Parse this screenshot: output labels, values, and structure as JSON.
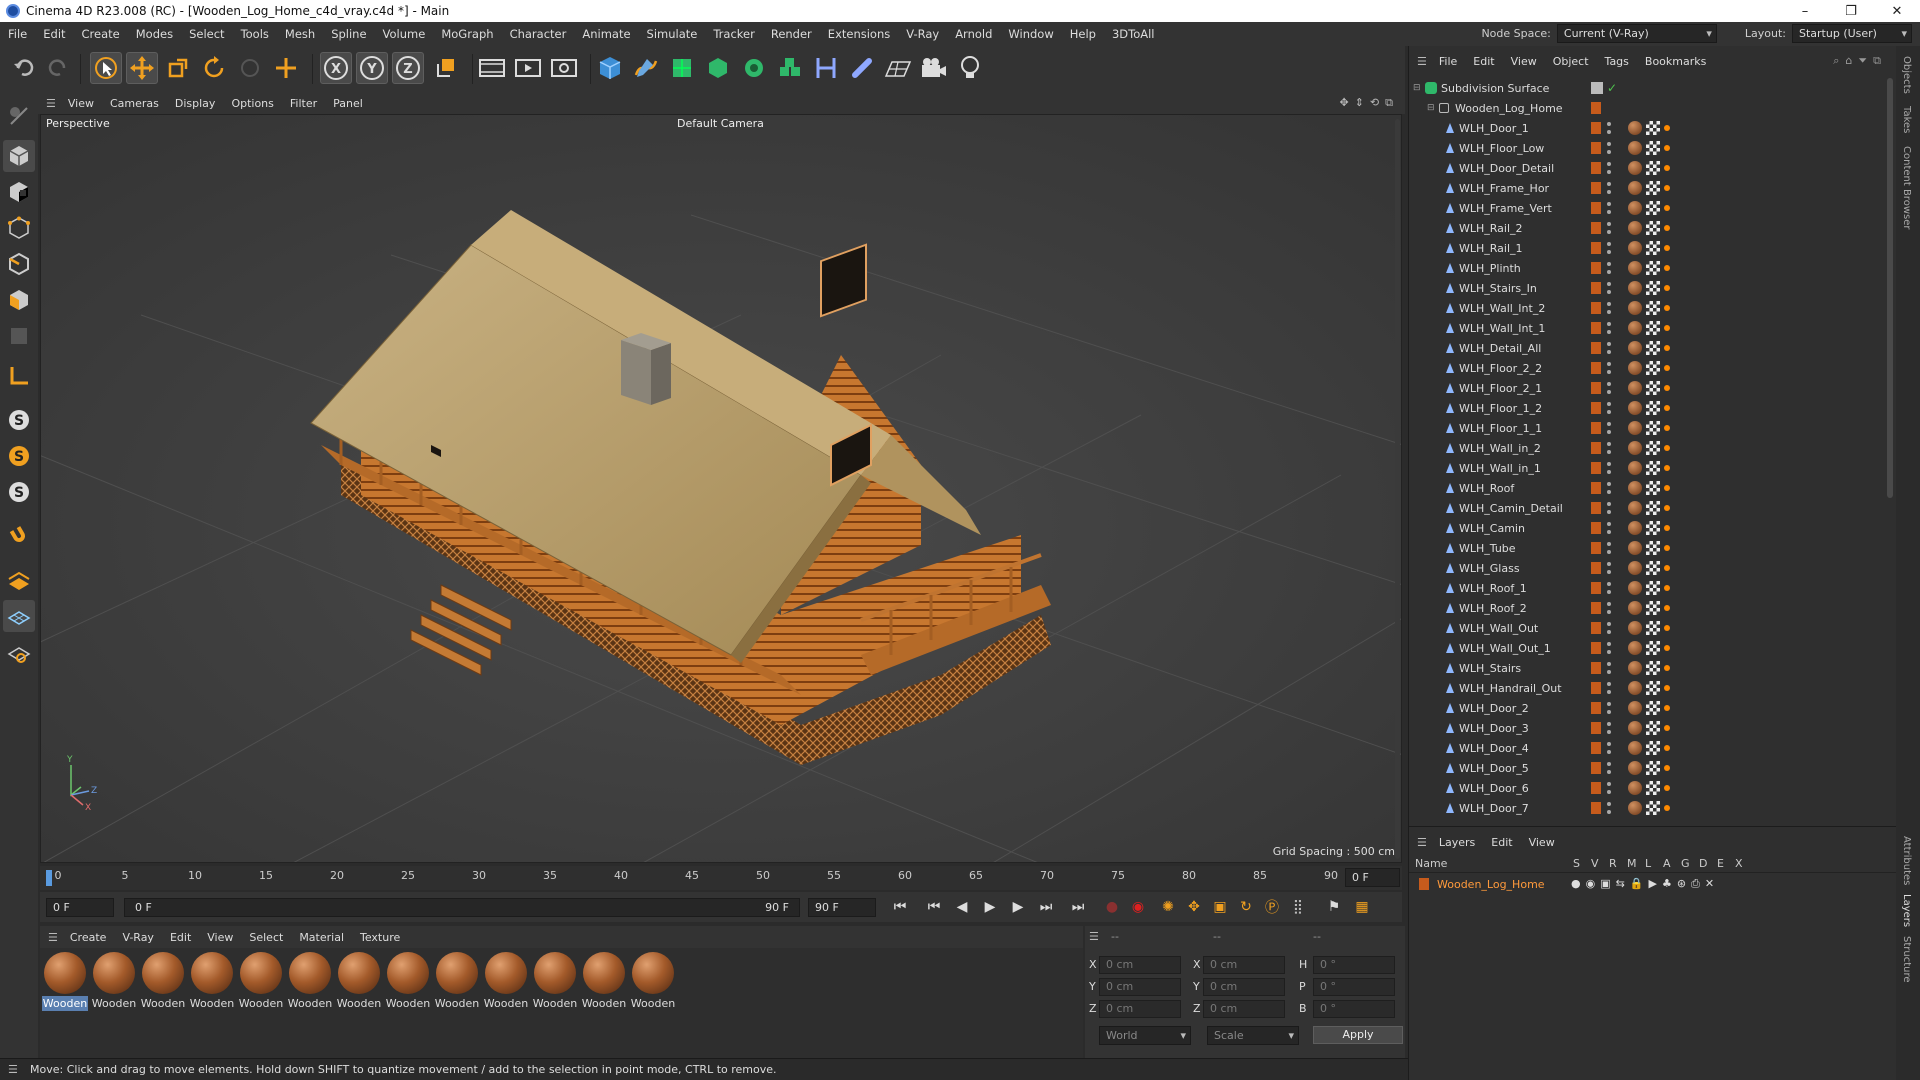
{
  "window": {
    "title": "Cinema 4D R23.008 (RC) - [Wooden_Log_Home_c4d_vray.c4d *] - Main",
    "controls": [
      "–",
      "❐",
      "✕"
    ]
  },
  "menubar": {
    "items": [
      "File",
      "Edit",
      "Create",
      "Modes",
      "Select",
      "Tools",
      "Mesh",
      "Spline",
      "Volume",
      "MoGraph",
      "Character",
      "Animate",
      "Simulate",
      "Tracker",
      "Render",
      "Extensions",
      "V-Ray",
      "Arnold",
      "Window",
      "Help",
      "3DToAll"
    ],
    "node_space_label": "Node Space:",
    "node_space_value": "Current (V-Ray)",
    "layout_label": "Layout:",
    "layout_value": "Startup (User)"
  },
  "viewport": {
    "menu": [
      "View",
      "Cameras",
      "Display",
      "Options",
      "Filter",
      "Panel"
    ],
    "name": "Perspective",
    "camera": "Default Camera",
    "grid_spacing": "Grid Spacing : 500 cm",
    "axis_labels": {
      "y": "Y",
      "z": "Z",
      "x": "X"
    }
  },
  "timeline": {
    "ticks": [
      "0",
      "5",
      "10",
      "15",
      "20",
      "25",
      "30",
      "35",
      "40",
      "45",
      "50",
      "55",
      "60",
      "65",
      "70",
      "75",
      "80",
      "85",
      "90"
    ],
    "current_frame_field": "0 F",
    "start_field": "0 F",
    "range_start": "0 F",
    "range_end": "90 F",
    "end_field": "90 F"
  },
  "materials": {
    "menu": [
      "Create",
      "V-Ray",
      "Edit",
      "View",
      "Select",
      "Material",
      "Texture"
    ],
    "items": [
      "Wooden",
      "Wooden",
      "Wooden",
      "Wooden",
      "Wooden",
      "Wooden",
      "Wooden",
      "Wooden",
      "Wooden",
      "Wooden",
      "Wooden",
      "Wooden",
      "Wooden"
    ]
  },
  "coordinates": {
    "headers": [
      "--",
      "--",
      "--"
    ],
    "rows": [
      {
        "a_label": "X",
        "a_val": "0 cm",
        "b_label": "X",
        "b_val": "0 cm",
        "c_label": "H",
        "c_val": "0 °"
      },
      {
        "a_label": "Y",
        "a_val": "0 cm",
        "b_label": "Y",
        "b_val": "0 cm",
        "c_label": "P",
        "c_val": "0 °"
      },
      {
        "a_label": "Z",
        "a_val": "0 cm",
        "b_label": "Z",
        "b_val": "0 cm",
        "c_label": "B",
        "c_val": "0 °"
      }
    ],
    "space": "World",
    "mode": "Scale",
    "apply": "Apply"
  },
  "status": "Move: Click and drag to move elements. Hold down SHIFT to quantize movement / add to the selection in point mode, CTRL to remove.",
  "objects": {
    "menu": [
      "File",
      "Edit",
      "View",
      "Object",
      "Tags",
      "Bookmarks"
    ],
    "root": "Subdivision Surface",
    "group": "Wooden_Log_Home",
    "children": [
      "WLH_Door_1",
      "WLH_Floor_Low",
      "WLH_Door_Detail",
      "WLH_Frame_Hor",
      "WLH_Frame_Vert",
      "WLH_Rail_2",
      "WLH_Rail_1",
      "WLH_Plinth",
      "WLH_Stairs_In",
      "WLH_Wall_Int_2",
      "WLH_Wall_Int_1",
      "WLH_Detail_All",
      "WLH_Floor_2_2",
      "WLH_Floor_2_1",
      "WLH_Floor_1_2",
      "WLH_Floor_1_1",
      "WLH_Wall_in_2",
      "WLH_Wall_in_1",
      "WLH_Roof",
      "WLH_Camin_Detail",
      "WLH_Camin",
      "WLH_Tube",
      "WLH_Glass",
      "WLH_Roof_1",
      "WLH_Roof_2",
      "WLH_Wall_Out",
      "WLH_Wall_Out_1",
      "WLH_Stairs",
      "WLH_Handrail_Out",
      "WLH_Door_2",
      "WLH_Door_3",
      "WLH_Door_4",
      "WLH_Door_5",
      "WLH_Door_6",
      "WLH_Door_7"
    ]
  },
  "layers": {
    "menu": [
      "Layers",
      "Edit",
      "View"
    ],
    "name_header": "Name",
    "col_headers": [
      "S",
      "V",
      "R",
      "M",
      "L",
      "A",
      "G",
      "D",
      "E",
      "X"
    ],
    "layer_name": "Wooden_Log_Home"
  },
  "side_tabs": [
    "Objects",
    "Takes",
    "Content Browser",
    "Attributes",
    "Layers",
    "Structure"
  ],
  "colors": {
    "accent": "#5a7fb0",
    "layer_name": "#ff9a3c",
    "wood": "#c8782e",
    "roof": "#b9a06a"
  }
}
